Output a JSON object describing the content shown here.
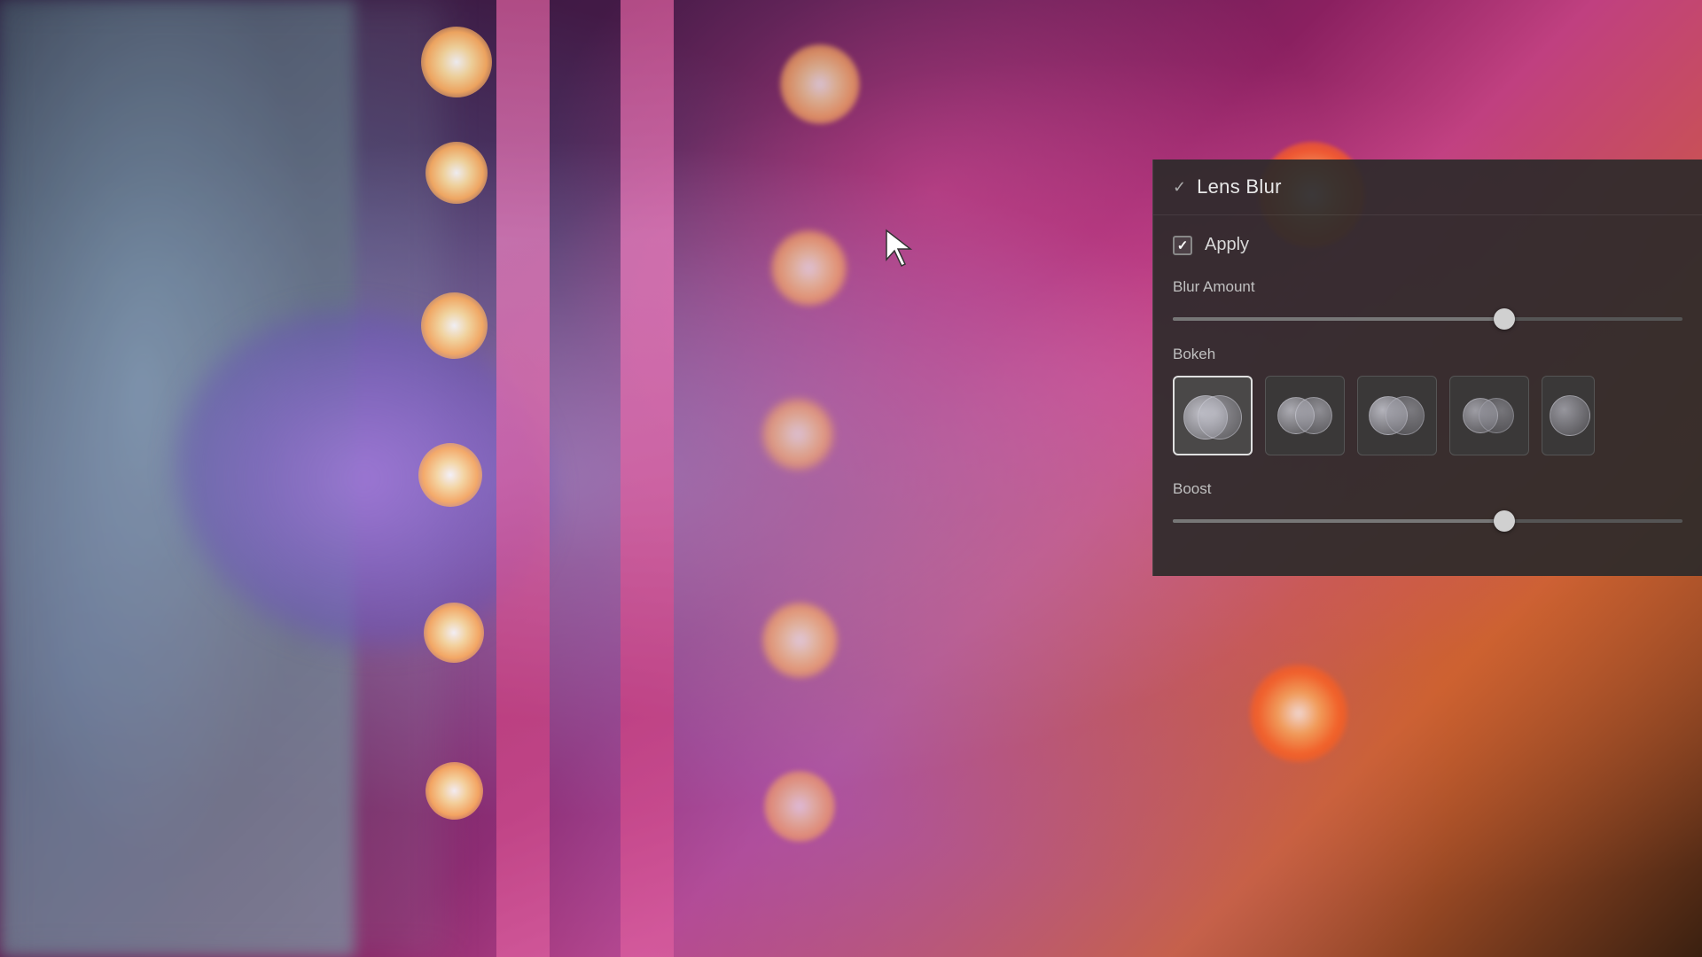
{
  "panel": {
    "title": "Lens Blur",
    "collapse_icon": "chevron-down",
    "apply_label": "Apply",
    "apply_checked": true,
    "blur_amount_label": "Blur Amount",
    "blur_amount_value": 65,
    "bokeh_label": "Bokeh",
    "boost_label": "Boost",
    "boost_value": 65,
    "bokeh_items": [
      {
        "id": 1,
        "label": "bokeh-style-1",
        "selected": true
      },
      {
        "id": 2,
        "label": "bokeh-style-2",
        "selected": false
      },
      {
        "id": 3,
        "label": "bokeh-style-3",
        "selected": false
      },
      {
        "id": 4,
        "label": "bokeh-style-4",
        "selected": false
      },
      {
        "id": 5,
        "label": "bokeh-style-5",
        "selected": false
      }
    ]
  },
  "colors": {
    "panel_bg": "rgba(45, 42, 42, 0.92)",
    "title_color": "#e8e8e8",
    "label_color": "#c0c0c0",
    "slider_thumb": "#d0d0d0",
    "accent": "#888888"
  }
}
